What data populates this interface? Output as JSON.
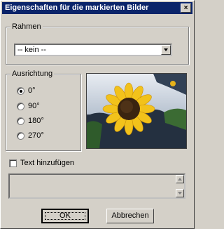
{
  "window": {
    "title": "Eigenschaften für die markierten Bilder",
    "close_glyph": "×"
  },
  "frame_group": {
    "legend": "Rahmen",
    "selected_value": "-- kein --"
  },
  "orientation_group": {
    "legend": "Ausrichtung",
    "options": [
      {
        "label": "0°",
        "selected": true
      },
      {
        "label": "90°",
        "selected": false
      },
      {
        "label": "180°",
        "selected": false
      },
      {
        "label": "270°",
        "selected": false
      }
    ]
  },
  "preview": {
    "icon": "sunflower-photo"
  },
  "add_text": {
    "label": "Text hinzufügen",
    "checked": false
  },
  "buttons": {
    "ok": "OK",
    "cancel": "Abbrechen"
  }
}
